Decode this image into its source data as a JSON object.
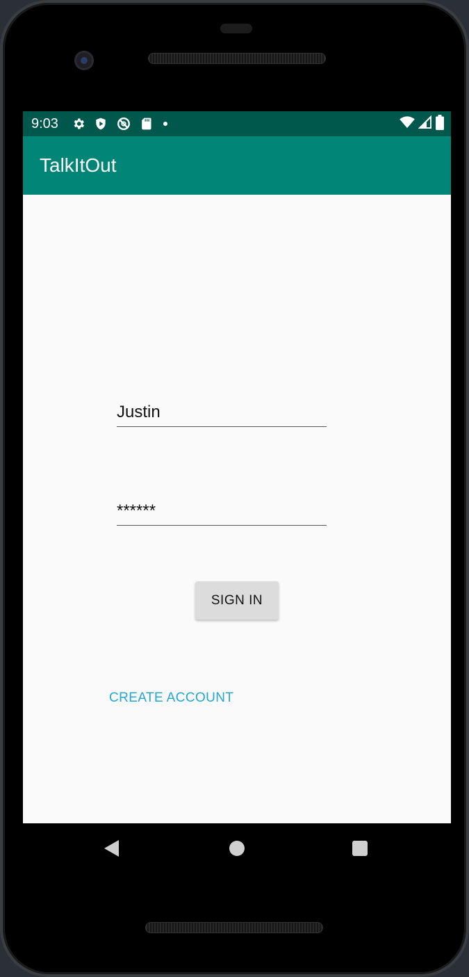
{
  "status_bar": {
    "time": "9:03",
    "left_icons": [
      "gear-icon",
      "shield-play-icon",
      "do-not-disturb-icon",
      "sd-card-icon",
      "dot-icon"
    ],
    "right_icons": [
      "wifi-icon",
      "cell-signal-icon",
      "battery-icon"
    ]
  },
  "app_bar": {
    "title": "TalkItOut"
  },
  "login": {
    "username_value": "Justin",
    "password_value": "******",
    "sign_in_label": "SIGN IN",
    "create_account_label": "CREATE ACCOUNT"
  },
  "nav_bar": {
    "buttons": [
      "back-icon",
      "home-icon",
      "recents-icon"
    ]
  },
  "colors": {
    "status_bar": "#00574b",
    "app_bar": "#008577",
    "background": "#fafafa",
    "link": "#23a6cf",
    "button": "#dcdcdc"
  }
}
